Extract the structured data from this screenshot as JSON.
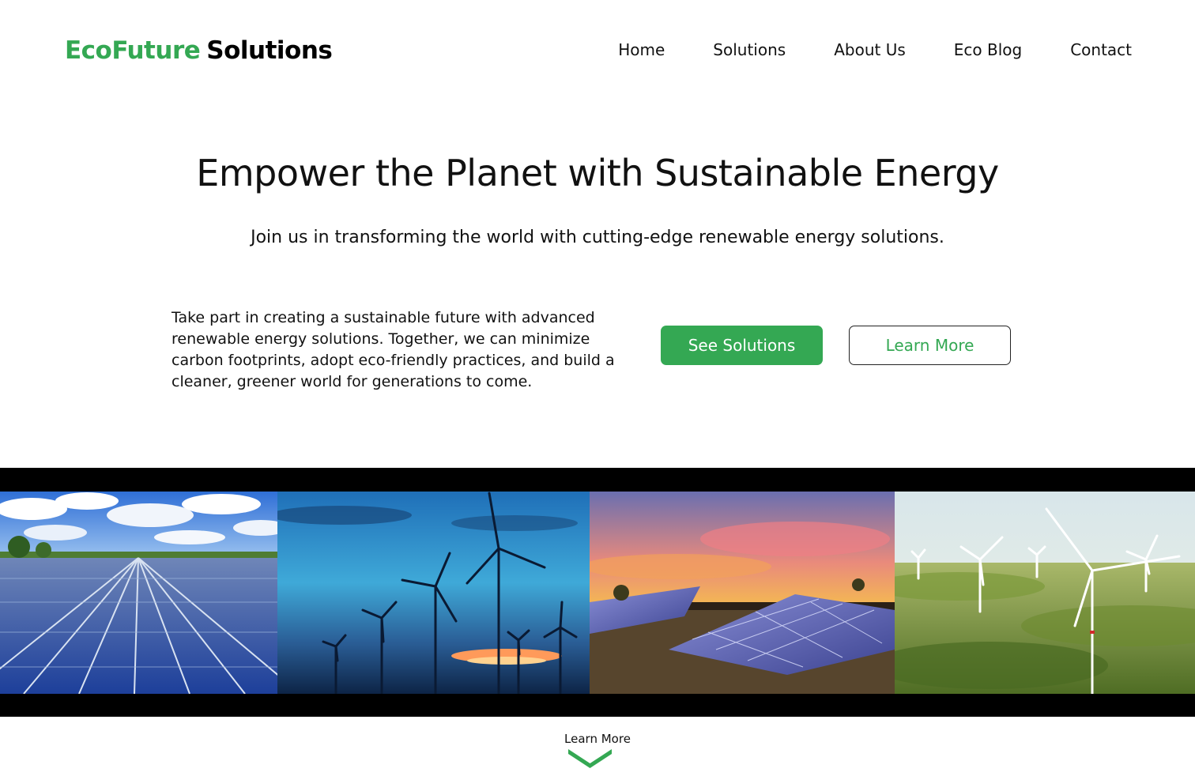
{
  "brand": {
    "part1": "EcoFuture",
    "part2": "Solutions"
  },
  "nav": [
    "Home",
    "Solutions",
    "About Us",
    "Eco Blog",
    "Contact"
  ],
  "hero": {
    "title": "Empower the Planet with Sustainable Energy",
    "subtitle": "Join us in transforming the world with cutting-edge renewable energy solutions.",
    "body": "Take part in creating a sustainable future with advanced renewable energy solutions. Together, we can minimize carbon footprints, adopt eco-friendly practices, and build a cleaner, greener world for generations to come."
  },
  "buttons": {
    "primary": "See Solutions",
    "secondary": "Learn More"
  },
  "scroll_cta": {
    "label": "Learn More",
    "icon": "chevron-down-icon"
  },
  "colors": {
    "accent": "#34a853",
    "text": "#111111",
    "strip": "#000000"
  }
}
